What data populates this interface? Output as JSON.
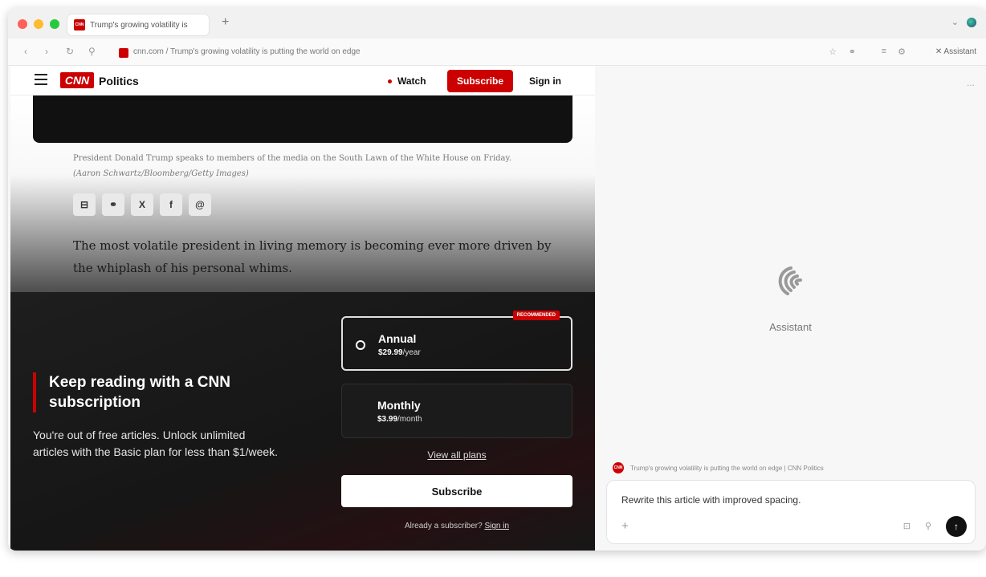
{
  "browser": {
    "tab_title": "Trump's growing volatility is",
    "favicon_text": "CNN",
    "new_tab_label": "+",
    "url": "cnn.com / Trump's growing volatility is putting the world on edge",
    "assistant_toggle_label": "Assistant"
  },
  "header": {
    "logo_text": "CNN",
    "section": "Politics",
    "watch_label": "Watch",
    "subscribe_label": "Subscribe",
    "signin_label": "Sign in"
  },
  "article": {
    "caption": "President Donald Trump speaks to members of the media on the South Lawn of the White House on Friday.",
    "caption_credit": "(Aaron Schwartz/Bloomberg/Getty Images)",
    "share_icons": [
      "email-icon",
      "link-icon",
      "x-icon",
      "facebook-icon",
      "threads-icon"
    ],
    "lead": "The most volatile president in living memory is becoming ever more driven by the whiplash of his personal whims."
  },
  "paywall": {
    "title": "Keep reading with a CNN subscription",
    "description": "You're out of free articles. Unlock unlimited articles with the Basic plan for less than $1/week.",
    "plans": [
      {
        "badge": "RECOMMENDED",
        "name": "Annual",
        "price": "$29.99",
        "period": "/year"
      },
      {
        "name": "Monthly",
        "price": "$3.99",
        "period": "/month"
      }
    ],
    "view_all": "View all plans",
    "subscribe_label": "Subscribe",
    "already_text": "Already a subscriber?",
    "signin_link": "Sign in"
  },
  "assistant": {
    "more_label": "...",
    "name": "Assistant",
    "context_title": "Trump's growing volatility is putting the world on edge | CNN Politics",
    "prompt": "Rewrite this article with improved spacing.",
    "plus_label": "+",
    "send_label": "↑"
  },
  "colors": {
    "cnn_red": "#cc0000",
    "paywall_bg": "#1e1e1e",
    "panel_bg": "#f7f7f7"
  }
}
